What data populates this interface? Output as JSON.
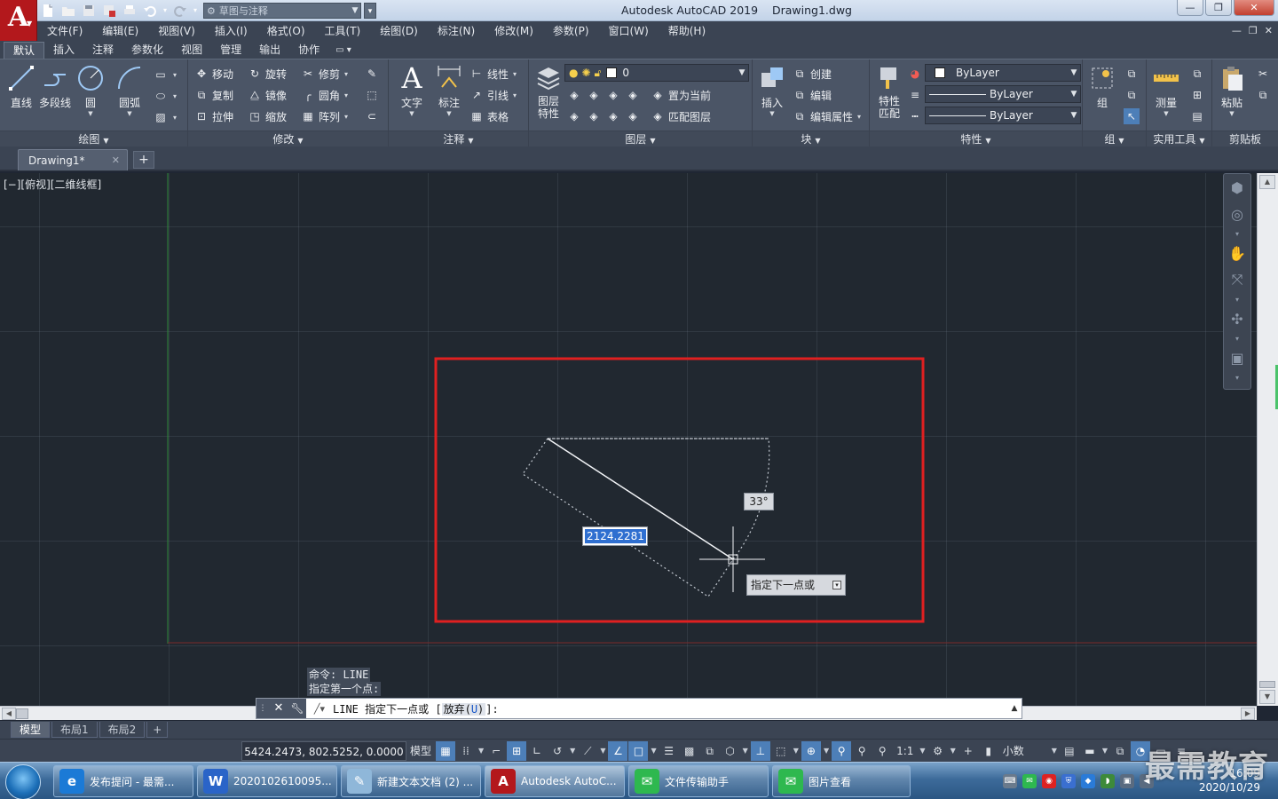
{
  "app": {
    "title": "Autodesk AutoCAD 2019",
    "filename": "Drawing1.dwg",
    "logo_letter": "A"
  },
  "qat": {
    "workspace": "草图与注释"
  },
  "menu": [
    {
      "label": "文件(F)"
    },
    {
      "label": "编辑(E)"
    },
    {
      "label": "视图(V)"
    },
    {
      "label": "插入(I)"
    },
    {
      "label": "格式(O)"
    },
    {
      "label": "工具(T)"
    },
    {
      "label": "绘图(D)"
    },
    {
      "label": "标注(N)"
    },
    {
      "label": "修改(M)"
    },
    {
      "label": "参数(P)"
    },
    {
      "label": "窗口(W)"
    },
    {
      "label": "帮助(H)"
    }
  ],
  "ribbon_tabs": [
    {
      "label": "默认"
    },
    {
      "label": "插入"
    },
    {
      "label": "注释"
    },
    {
      "label": "参数化"
    },
    {
      "label": "视图"
    },
    {
      "label": "管理"
    },
    {
      "label": "输出"
    },
    {
      "label": "协作"
    }
  ],
  "ribbon": {
    "draw": {
      "title": "绘图",
      "line": "直线",
      "polyline": "多段线",
      "circle": "圆",
      "arc": "圆弧"
    },
    "modify": {
      "title": "修改",
      "move": "移动",
      "rotate": "旋转",
      "trim": "修剪",
      "copy": "复制",
      "mirror": "镜像",
      "fillet": "圆角",
      "stretch": "拉伸",
      "scale": "缩放",
      "array": "阵列"
    },
    "annotation": {
      "title": "注释",
      "text": "文字",
      "dimension": "标注",
      "linear": "线性",
      "leader": "引线",
      "table": "表格"
    },
    "layers": {
      "title": "图层",
      "layer_props_1": "图层",
      "layer_props_2": "特性",
      "current_layer": "0",
      "set_current": "置为当前",
      "match_layer": "匹配图层"
    },
    "block": {
      "title": "块",
      "insert": "插入",
      "create": "创建",
      "edit": "编辑",
      "edit_attr": "编辑属性"
    },
    "properties": {
      "title": "特性",
      "match_1": "特性",
      "match_2": "匹配",
      "color": "ByLayer",
      "linetype": "ByLayer",
      "lineweight": "ByLayer"
    },
    "groups": {
      "title": "组",
      "group": "组"
    },
    "utilities": {
      "title": "实用工具",
      "measure": "测量"
    },
    "clipboard": {
      "title": "剪贴板",
      "paste": "粘贴"
    }
  },
  "file_tab": {
    "label": "Drawing1*"
  },
  "viewport": {
    "label": "[−][俯视][二维线框]"
  },
  "drawing": {
    "angle_tooltip": "33°",
    "length_input": "2124.2281",
    "prompt_tooltip": "指定下一点或",
    "highlight_color": "#e02020"
  },
  "command": {
    "history": [
      "命令: LINE",
      "指定第一个点:"
    ],
    "prompt_prefix": "LINE 指定下一点或 [",
    "option_text": "放弃(",
    "option_key": "U",
    "option_close": ")",
    "prompt_suffix": "]:"
  },
  "layout_tabs": [
    {
      "label": "模型"
    },
    {
      "label": "布局1"
    },
    {
      "label": "布局2"
    }
  ],
  "status": {
    "coords": "5424.2473, 802.5252, 0.0000",
    "model": "模型",
    "scale": "1:1",
    "units": "小数"
  },
  "taskbar": [
    {
      "label": "发布提问 - 最需..."
    },
    {
      "label": "2020102610095..."
    },
    {
      "label": "新建文本文档 (2) ..."
    },
    {
      "label": "Autodesk AutoC..."
    },
    {
      "label": "文件传输助手"
    },
    {
      "label": "图片查看"
    }
  ],
  "clock": {
    "time": "16:09",
    "date": "2020/10/29"
  },
  "watermark": "最需教育"
}
